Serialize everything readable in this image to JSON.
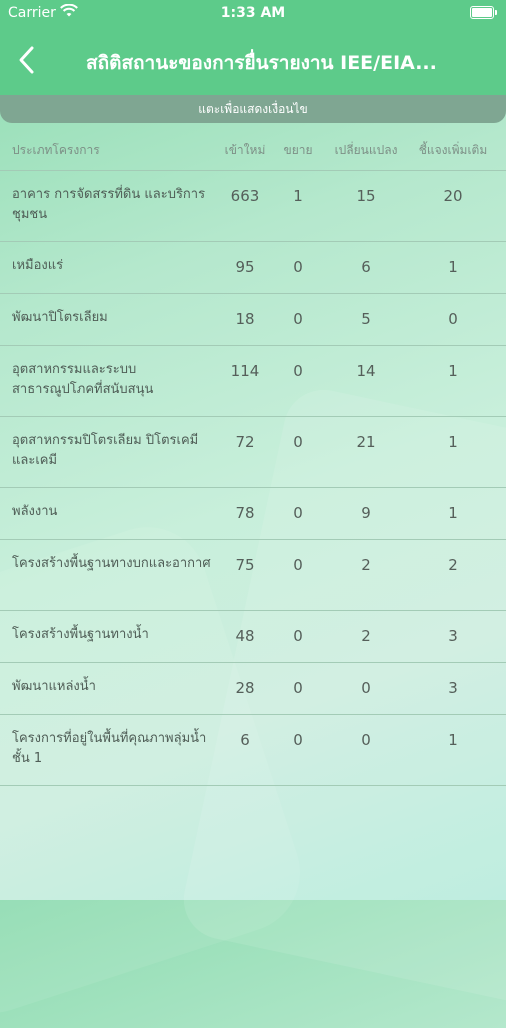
{
  "status_bar": {
    "carrier": "Carrier",
    "time": "1:33 AM"
  },
  "nav": {
    "title": "สถิติสถานะของการยื่นรายงาน IEE/EIA..."
  },
  "subbar": {
    "label": "แตะเพื่อแสดงเงื่อนไข"
  },
  "table": {
    "headers": [
      "ประเภทโครงการ",
      "เข้าใหม่",
      "ขยาย",
      "เปลี่ยนแปลง",
      "ชี้แจงเพิ่มเติม"
    ],
    "rows": [
      {
        "type": "อาคาร การจัดสรรที่ดิน และบริการชุมชน",
        "new": "663",
        "expand": "1",
        "change": "15",
        "clarify": "20"
      },
      {
        "type": "เหมืองแร่",
        "new": "95",
        "expand": "0",
        "change": "6",
        "clarify": "1"
      },
      {
        "type": "พัฒนาปิโตรเลียม",
        "new": "18",
        "expand": "0",
        "change": "5",
        "clarify": "0"
      },
      {
        "type": "อุตสาหกรรมและระบบสาธารณูปโภคที่สนับสนุน",
        "new": "114",
        "expand": "0",
        "change": "14",
        "clarify": "1"
      },
      {
        "type": "อุตสาหกรรมปิโตรเลียม ปิโตรเคมีและเคมี",
        "new": "72",
        "expand": "0",
        "change": "21",
        "clarify": "1"
      },
      {
        "type": "พลังงาน",
        "new": "78",
        "expand": "0",
        "change": "9",
        "clarify": "1"
      },
      {
        "type": "โครงสร้างพื้นฐานทางบกและอากาศ",
        "new": "75",
        "expand": "0",
        "change": "2",
        "clarify": "2"
      },
      {
        "type": "โครงสร้างพื้นฐานทางน้ำ",
        "new": "48",
        "expand": "0",
        "change": "2",
        "clarify": "3"
      },
      {
        "type": "พัฒนาแหล่งน้ำ",
        "new": "28",
        "expand": "0",
        "change": "0",
        "clarify": "3"
      },
      {
        "type": "โครงการที่อยู่ในพื้นที่คุณภาพลุ่มน้ำชั้น 1",
        "new": "6",
        "expand": "0",
        "change": "0",
        "clarify": "1"
      }
    ]
  }
}
